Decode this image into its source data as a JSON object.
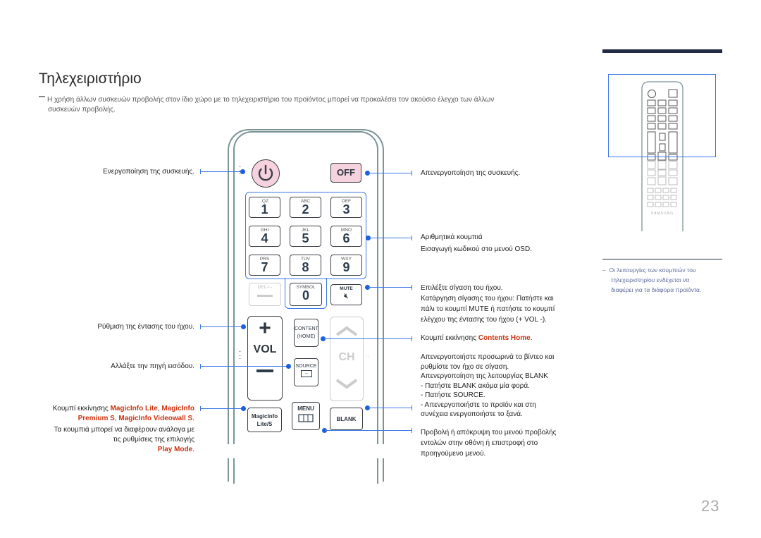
{
  "page": {
    "title": "Τηλεχειριστήριο",
    "note_line1": "Η χρήση άλλων συσκευών προβολής στον ίδιο χώρο με το τηλεχειριστήριο του προϊόντος μπορεί να προκαλέσει τον ακούσιο έλεγχο των άλλων",
    "note_line2": "συσκευών προβολής.",
    "page_number": "23"
  },
  "sidebar": {
    "note_lines": [
      "Οι λειτουργίες των κουμπιών του",
      "τηλεχειριστηρίου ενδέχεται να",
      "διαφέρει για τα διάφορα προϊόντα."
    ],
    "thumbnail_brand": "SAMSUNG"
  },
  "remote": {
    "power_icon": "power-icon",
    "off_label": "OFF",
    "keys": [
      {
        "sub": ".QZ",
        "num": "1"
      },
      {
        "sub": "ABC",
        "num": "2"
      },
      {
        "sub": "DEF",
        "num": "3"
      },
      {
        "sub": "GHI",
        "num": "4"
      },
      {
        "sub": "JKL",
        "num": "5"
      },
      {
        "sub": "MNO",
        "num": "6"
      },
      {
        "sub": "PRS",
        "num": "7"
      },
      {
        "sub": "TUV",
        "num": "8"
      },
      {
        "sub": "WXY",
        "num": "9"
      }
    ],
    "del_label": "DEL-/--",
    "symbol_label": "SYMBOL",
    "zero_label": "0",
    "mute_label": "MUTE",
    "vol_plus": "+",
    "vol_label": "VOL",
    "vol_minus": "—",
    "content_label_1": "CONTENT",
    "content_label_2": "(HOME)",
    "source_label": "SOURCE",
    "ch_label": "CH",
    "magicinfo_label_1": "MagicInfo",
    "magicinfo_label_2": "Lite/S",
    "menu_label": "MENU",
    "blank_label": "BLANK"
  },
  "left_labels": {
    "power_on": "Ενεργοποίηση της συσκευής.",
    "volume": "Ρύθμιση της έντασης του ήχου.",
    "source": "Αλλάξτε την πηγή εισόδου.",
    "magicinfo_prefix": "Κουμπί εκκίνησης ",
    "magicinfo_red1": "MagicInfo Lite",
    "magicinfo_sep1": ", ",
    "magicinfo_red2": "MagicInfo",
    "magicinfo_red3": "Premium S",
    "magicinfo_sep2": ", ",
    "magicinfo_red4": "MagicInfo Videowall S",
    "magicinfo_end": ".",
    "magicinfo_note_1": "Τα κουμπιά μπορεί να διαφέρουν ανάλογα με",
    "magicinfo_note_2": "τις ρυθμίσεις της επιλογής",
    "magicinfo_note_red": "Play Mode",
    "magicinfo_note_end": "."
  },
  "right_labels": {
    "power_off": "Απενεργοποίηση της συσκευής.",
    "numeric_1": "Αριθμητικά κουμπιά",
    "numeric_2": "Εισαγωγή κωδικού στο μενού OSD.",
    "mute_1": "Επιλέξτε σίγαση του ήχου.",
    "mute_2": "Κατάργηση σίγασης του ήχου: Πατήστε και",
    "mute_3": "πάλι το κουμπί MUTE ή πατήστε το κουμπί",
    "mute_4": "ελέγχου της έντασης του ήχου (+ VOL -).",
    "content_prefix": "Κουμπί εκκίνησης ",
    "content_red": "Contents Home",
    "content_end": ".",
    "blank_1": "Απενεργοποιήστε προσωρινά το βίντεο και",
    "blank_2": "ρυθμίστε τον ήχο σε σίγαση.",
    "blank_3": "Απενεργοποίηση της λειτουργίας BLANK",
    "blank_4": "- Πατήστε BLANK ακόμα μία φορά.",
    "blank_5": "- Πατήστε SOURCE.",
    "blank_6": "- Απενεργοποιήστε το προϊόν και στη",
    "blank_7": "συνέχεια ενεργοποιήστε το ξανά.",
    "menu_1": "Προβολή ή απόκρυψη του μενού προβολής",
    "menu_2": "εντολών στην οθόνη ή επιστροφή στο",
    "menu_3": "προηγούμενο μενού."
  },
  "colors": {
    "accent_blue": "#3b78e7",
    "highlight_red": "#cc3311",
    "power_pink": "#f6d2de",
    "header_bar": "#232a46"
  }
}
